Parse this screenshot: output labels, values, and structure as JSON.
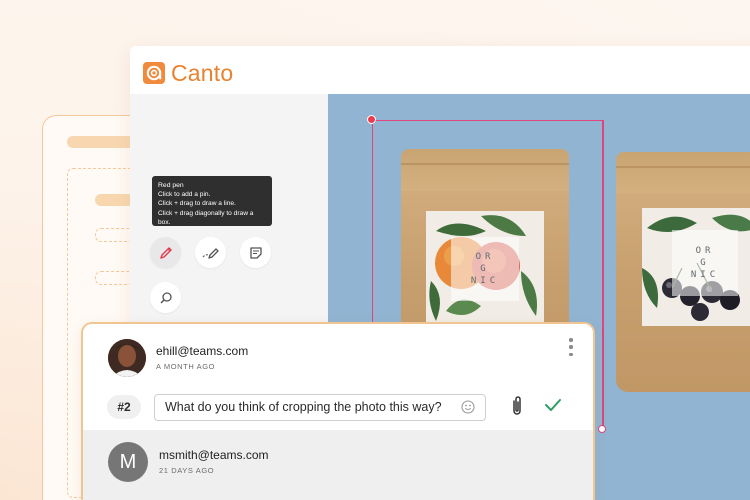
{
  "app": {
    "logo_text": "Canto"
  },
  "tooltip": {
    "title": "Red pen",
    "lines": [
      "Click to add a pin.",
      "Click + drag to draw a line.",
      "Click + drag diagonally to draw a box."
    ]
  },
  "tools": [
    {
      "icon": "red-pen-icon",
      "active": true
    },
    {
      "icon": "line-pen-icon",
      "active": false
    },
    {
      "icon": "note-icon",
      "active": false
    },
    {
      "icon": "zoom-icon",
      "active": false
    },
    {
      "icon": "magic-wand-icon",
      "active": false
    }
  ],
  "canvas": {
    "bag_text_left": [
      "OR",
      "G",
      "NIC"
    ],
    "bag_text_right": [
      "OR",
      "G",
      "NIC"
    ]
  },
  "comment": {
    "user": "ehill@teams.com",
    "time": "A MONTH AGO",
    "number": "#2",
    "reply_value": "What do you think of cropping the photo this way?"
  },
  "second_comment": {
    "initial": "M",
    "user": "msmith@teams.com",
    "time": "21 DAYS AGO"
  },
  "colors": {
    "accent": "#f08a3c",
    "selection": "#e0457b",
    "check": "#2e9d63",
    "canvas_bg": "#90b4d2"
  }
}
